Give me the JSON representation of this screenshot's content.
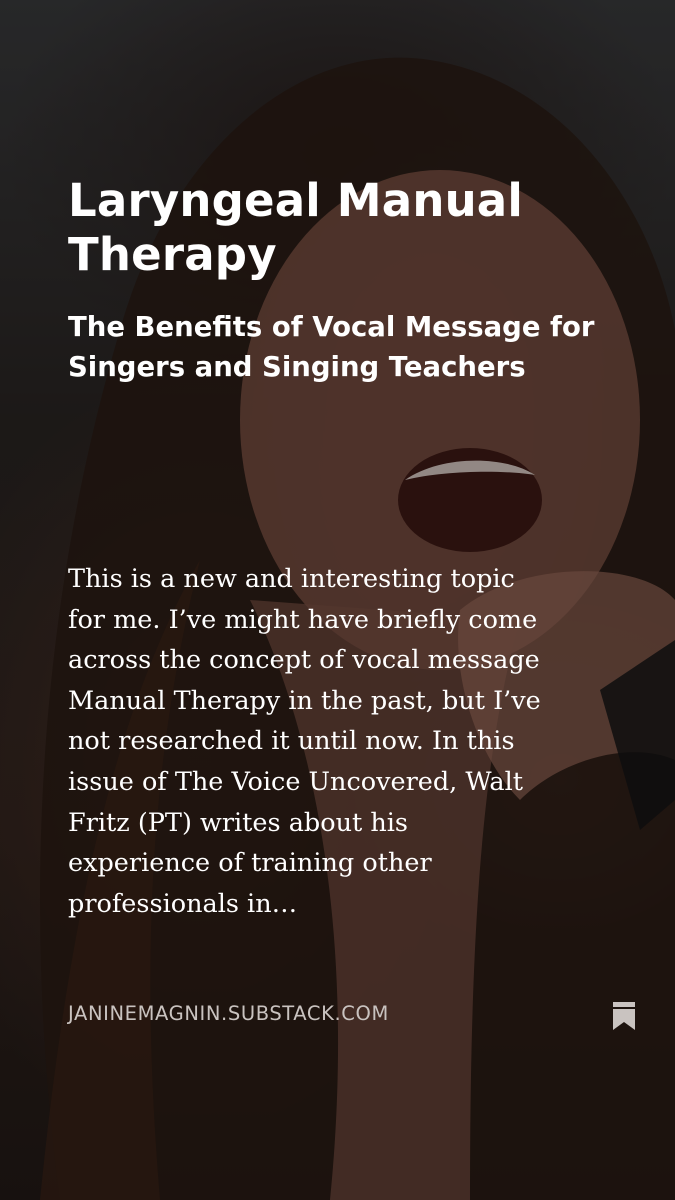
{
  "card": {
    "title": "Laryngeal Manual Therapy",
    "subtitle": "The Benefits of Vocal Message for Singers and Singing Teachers",
    "excerpt": "This is a new and interesting topic for me. I’ve might have briefly come across the concept of vocal message Manual Therapy in the past, but I’ve not researched it until now. In this issue of The Voice Uncovered, Walt Fritz (PT) writes about his experience of training other professionals in…",
    "domain": "JANINEMAGNIN.SUBSTACK.COM"
  },
  "icons": {
    "bookmark": "bookmark-icon"
  },
  "colors": {
    "text": "#ffffff",
    "domain_text": "#c9c3c0",
    "icon": "#c9c3c0"
  }
}
